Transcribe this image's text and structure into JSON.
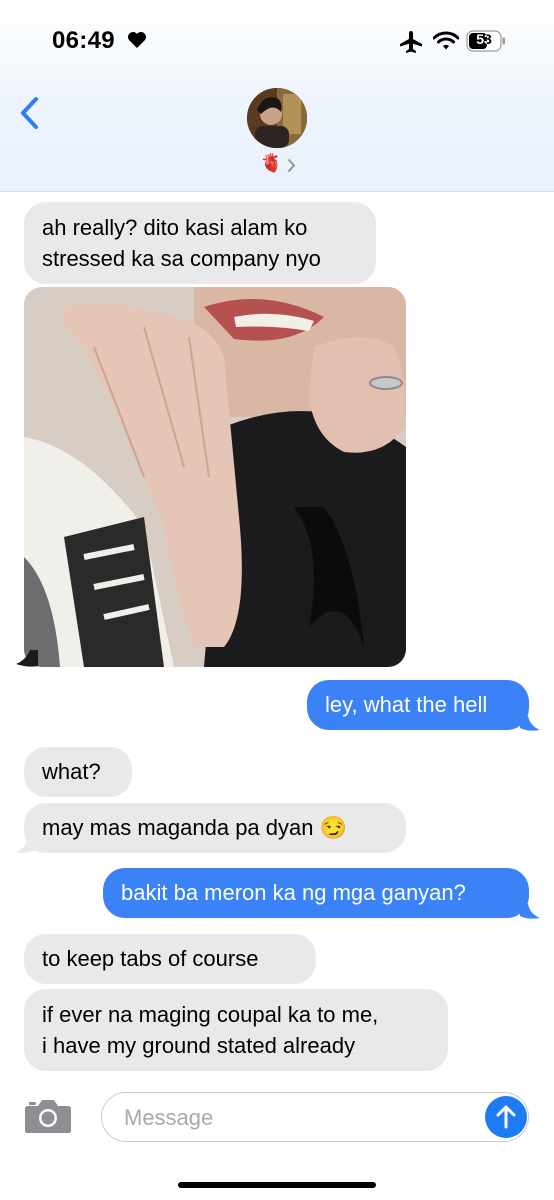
{
  "status_bar": {
    "time": "06:49",
    "battery": "53"
  },
  "header": {
    "contact_emoji": "🫀",
    "contact_chevron": "›"
  },
  "messages": [
    {
      "side": "in",
      "lines": [
        "ah really? dito kasi alam ko",
        "stressed ka sa company nyo"
      ]
    },
    {
      "side": "in",
      "type": "photo"
    },
    {
      "side": "out",
      "text": "ley, what the hell"
    },
    {
      "side": "in",
      "text": "what?"
    },
    {
      "side": "in",
      "text": "may mas maganda pa dyan 😏"
    },
    {
      "side": "out",
      "text": "bakit ba meron ka ng mga ganyan?"
    },
    {
      "side": "in",
      "text": "to keep tabs of course"
    },
    {
      "side": "in",
      "lines": [
        "if ever na maging coupal ka to me,",
        "i have my ground stated already"
      ]
    }
  ],
  "composer": {
    "placeholder": "Message"
  },
  "colors": {
    "incoming": "#e9e9eb",
    "outgoing": "#3b82f6",
    "accent": "#1e7cf2"
  }
}
